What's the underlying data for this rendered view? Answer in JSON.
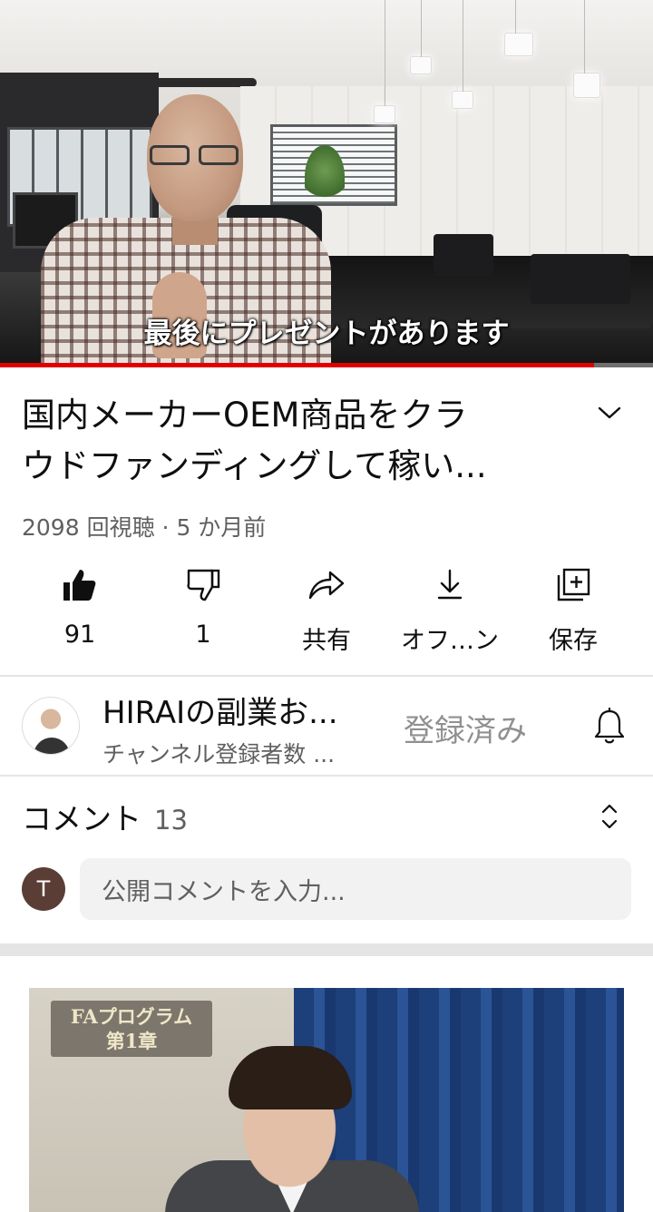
{
  "player": {
    "subtitle": "最後にプレゼントがあります",
    "progress": 0.91
  },
  "video": {
    "title_line1": "国内メーカーOEM商品をクラ",
    "title_line2": "ウドファンディングして稼い...",
    "views": "2098 回視聴",
    "separator": "·",
    "age": "5 か月前"
  },
  "actions": [
    {
      "label": "91",
      "icon": "thumbs-up-icon"
    },
    {
      "label": "1",
      "icon": "thumbs-down-icon"
    },
    {
      "label": "共有",
      "icon": "share-icon"
    },
    {
      "label": "オフ…ン",
      "icon": "download-icon"
    },
    {
      "label": "保存",
      "icon": "save-playlist-icon"
    }
  ],
  "channel": {
    "name": "HIRAIの副業お...",
    "subscribers": "チャンネル登録者数 ...",
    "subscribe_state": "登録済み"
  },
  "comments": {
    "title": "コメント",
    "count": "13",
    "user_initial": "T",
    "placeholder": "公開コメントを入力..."
  },
  "next_video": {
    "thumbnail_text_line1": "FAプログラム",
    "thumbnail_text_line2": "第1章"
  },
  "colors": {
    "progress": "#e00000",
    "secondary_text": "#606060",
    "divider": "#e5e5e5"
  }
}
